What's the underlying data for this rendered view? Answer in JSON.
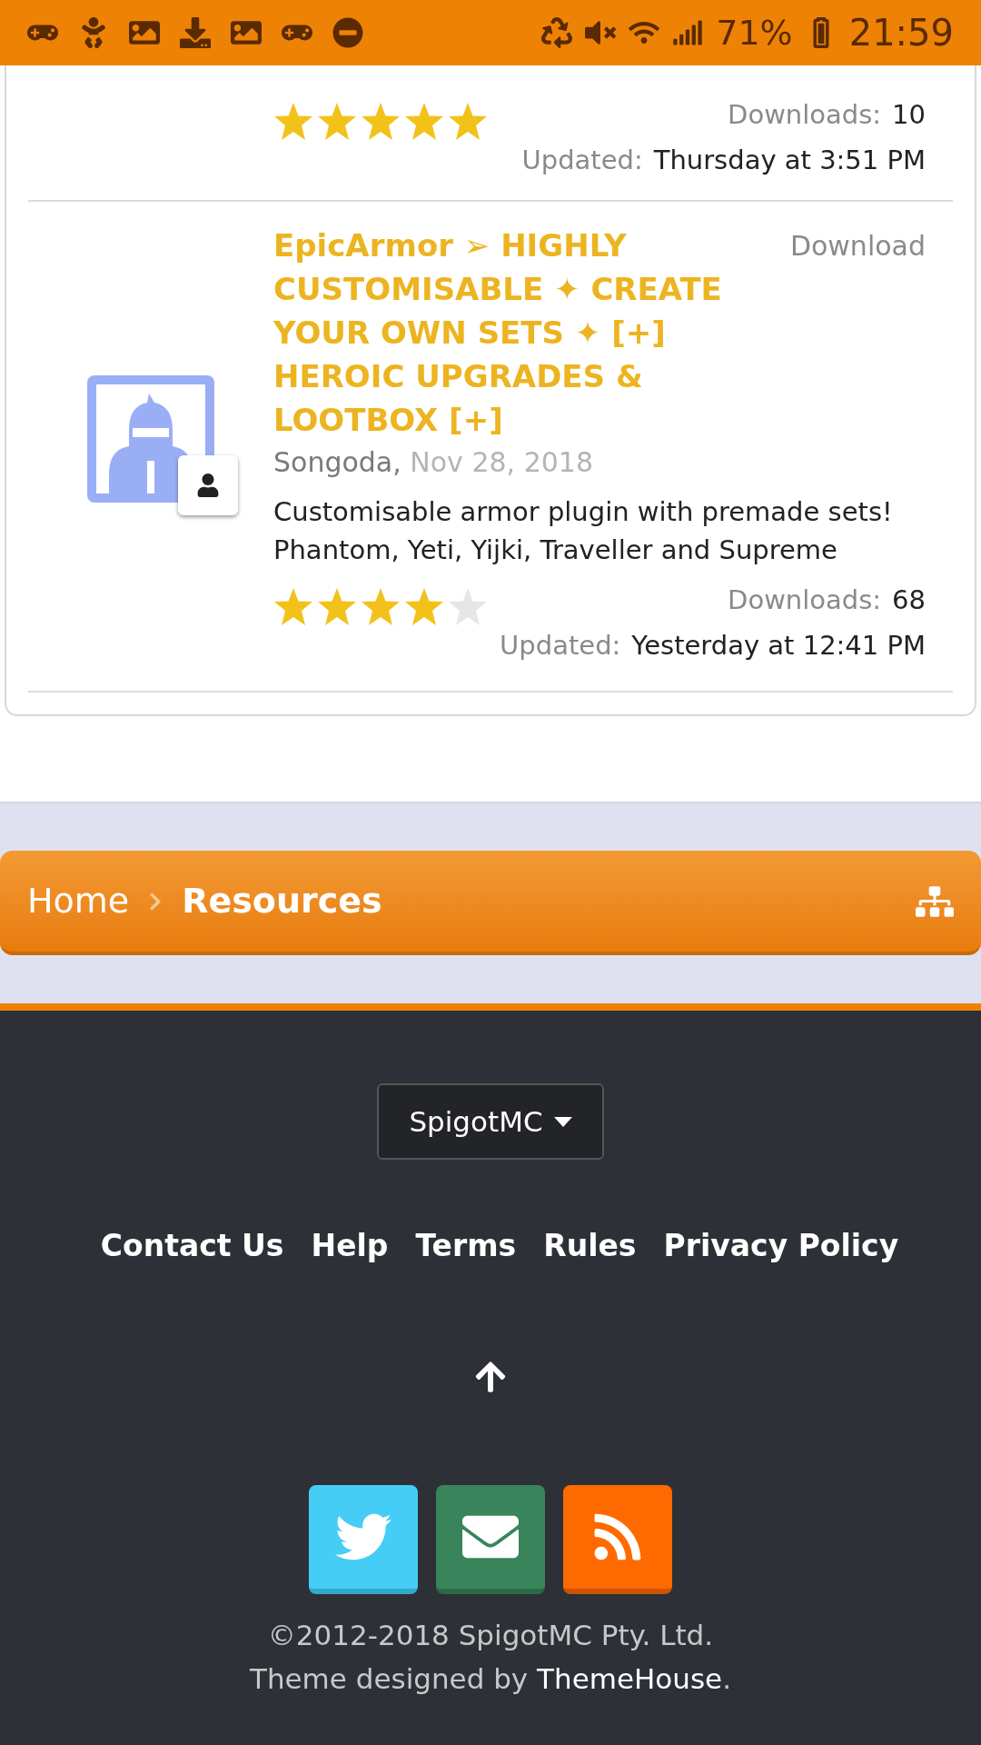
{
  "status_bar": {
    "battery": "71%",
    "time": "21:59"
  },
  "resources": [
    {
      "stars": 5,
      "downloads_label": "Downloads:",
      "downloads": "10",
      "updated_label": "Updated:",
      "updated": "Thursday at 3:51 PM"
    },
    {
      "title": "EpicArmor ➢ HIGHLY CUSTOMISABLE ✦ CREATE YOUR OWN SETS ✦ [+] HEROIC UPGRADES & LOOTBOX [+]",
      "download": "Download",
      "author": "Songoda,",
      "date": "Nov 28, 2018",
      "description": "Customisable armor plugin with premade sets! Phantom, Yeti, Yijki, Traveller and Supreme",
      "stars": 4,
      "downloads_label": "Downloads:",
      "downloads": "68",
      "updated_label": "Updated:",
      "updated": "Yesterday at 12:41 PM"
    }
  ],
  "breadcrumb": [
    {
      "label": "Home",
      "selected": false
    },
    {
      "label": "Resources",
      "selected": true
    }
  ],
  "footer": {
    "dropdown": "SpigotMC",
    "links": [
      "Contact Us",
      "Help",
      "Terms",
      "Rules",
      "Privacy Policy"
    ],
    "copyright": "©2012-2018 SpigotMC Pty. Ltd.",
    "credit_prefix": "Theme designed by",
    "credit_link": "ThemeHouse",
    "credit_suffix": "."
  }
}
